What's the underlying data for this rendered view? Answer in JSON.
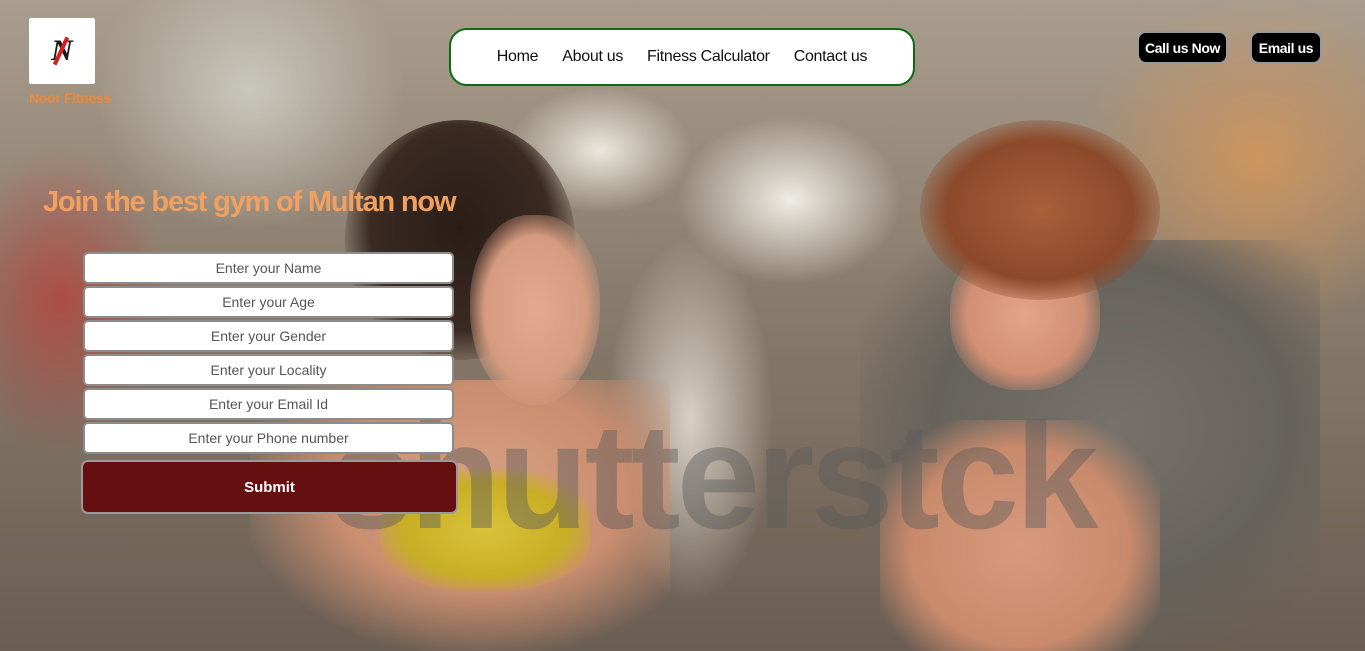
{
  "brand": {
    "logo_letter": "N",
    "name": "Noor Fitness"
  },
  "nav": {
    "items": [
      "Home",
      "About us",
      "Fitness Calculator",
      "Contact us"
    ]
  },
  "actions": {
    "call_label": "Call us Now",
    "email_label": "Email us"
  },
  "hero": {
    "headline": "Join the best gym of Multan now",
    "watermark": "shutterst",
    "watermark_tail": "ck"
  },
  "form": {
    "fields": [
      {
        "placeholder": "Enter your Name"
      },
      {
        "placeholder": "Enter your Age"
      },
      {
        "placeholder": "Enter your Gender"
      },
      {
        "placeholder": "Enter your Locality"
      },
      {
        "placeholder": "Enter your Email Id"
      },
      {
        "placeholder": "Enter your Phone number"
      }
    ],
    "submit_label": "Submit"
  },
  "colors": {
    "brand_orange": "#e98a3c",
    "headline_orange": "#f0a061",
    "nav_border_green": "#0b6a12",
    "submit_maroon": "#650f11"
  }
}
